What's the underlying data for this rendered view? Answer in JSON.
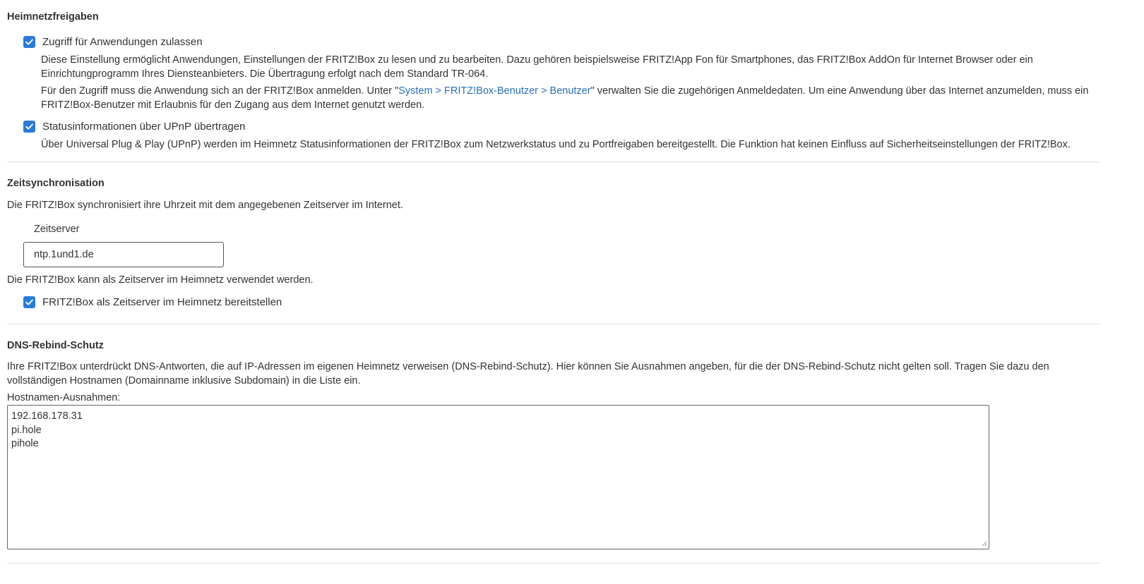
{
  "heimnetz": {
    "title": "Heimnetzfreigaben",
    "app_access": {
      "label": "Zugriff für Anwendungen zulassen",
      "checked": true,
      "desc_1": "Diese Einstellung ermöglicht Anwendungen, Einstellungen der FRITZ!Box zu lesen und zu bearbeiten. Dazu gehören beispielsweise FRITZ!App Fon für Smartphones, das FRITZ!Box AddOn für Internet Browser oder ein Einrichtungprogramm Ihres Diensteanbieters. Die Übertragung erfolgt nach dem Standard TR-064.",
      "desc_2_pre": "Für den Zugriff muss die Anwendung sich an der FRITZ!Box anmelden. Unter \"",
      "desc_2_link": "System > FRITZ!Box-Benutzer > Benutzer",
      "desc_2_post": "\" verwalten Sie die zugehörigen Anmeldedaten. Um eine Anwendung über das Internet anzumelden, muss ein FRITZ!Box-Benutzer mit Erlaubnis für den Zugang aus dem Internet genutzt werden."
    },
    "upnp": {
      "label": "Statusinformationen über UPnP übertragen",
      "checked": true,
      "desc": "Über Universal Plug & Play (UPnP) werden im Heimnetz Statusinformationen der FRITZ!Box zum Netzwerkstatus und zu Portfreigaben bereitgestellt. Die Funktion hat keinen Einfluss auf Sicherheitseinstellungen der FRITZ!Box."
    }
  },
  "zeit": {
    "title": "Zeitsynchronisation",
    "desc": "Die FRITZ!Box synchronisiert ihre Uhrzeit mit dem angegebenen Zeitserver im Internet.",
    "server_label": "Zeitserver",
    "server_value": "ntp.1und1.de",
    "local_desc": "Die FRITZ!Box kann als Zeitserver im Heimnetz verwendet werden.",
    "local_server": {
      "label": "FRITZ!Box als Zeitserver im Heimnetz bereitstellen",
      "checked": true
    }
  },
  "dns": {
    "title": "DNS-Rebind-Schutz",
    "desc": "Ihre FRITZ!Box unterdrückt DNS-Antworten, die auf IP-Adressen im eigenen Heimnetz verweisen (DNS-Rebind-Schutz). Hier können Sie Ausnahmen angeben, für die der DNS-Rebind-Schutz nicht gelten soll. Tragen Sie dazu den vollständigen Hostnamen (Domainname inklusive Subdomain) in die Liste ein.",
    "exceptions_label": "Hostnamen-Ausnahmen:",
    "exceptions_value": "192.168.178.31\npi.hole\npihole"
  },
  "colors": {
    "accent": "#2a7bd3",
    "link": "#2a6fb8",
    "text": "#333333",
    "divider": "#dddddd"
  },
  "icons": {
    "checkbox": "checkmark-icon",
    "textarea_resize": "resize-grip-icon"
  }
}
